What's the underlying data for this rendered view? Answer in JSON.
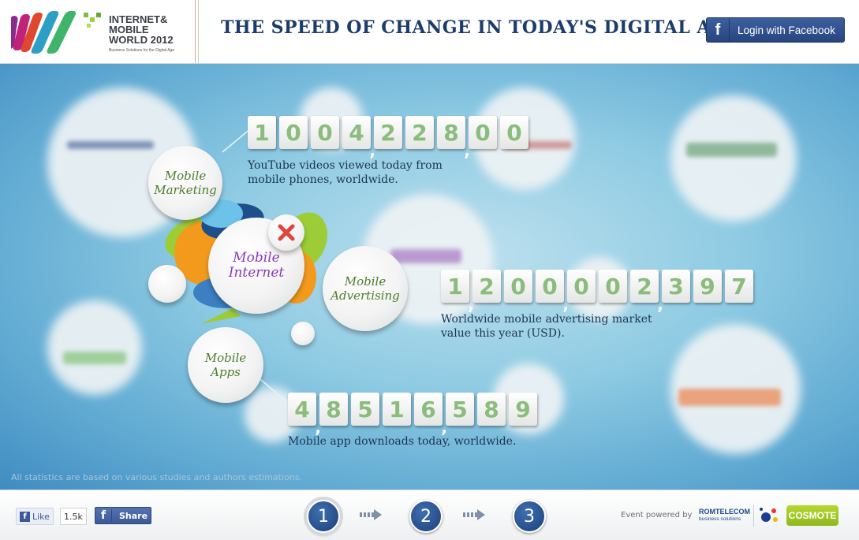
{
  "header": {
    "logo_title": "INTERNET& MOBILE WORLD 2012",
    "logo_subtitle": "Business Solutions for the Digital Age",
    "headline": "THE SPEED OF CHANGE IN TODAY'S DIGITAL AGE",
    "facebook_login_label": "Login with Facebook",
    "facebook_icon_glyph": "f"
  },
  "bubbles": {
    "mobile_internet": [
      "Mobile",
      "Internet"
    ],
    "mobile_marketing": [
      "Mobile",
      "Marketing"
    ],
    "mobile_advertising": [
      "Mobile",
      "Advertising"
    ],
    "mobile_apps": [
      "Mobile",
      "Apps"
    ]
  },
  "counters": [
    {
      "name": "youtube",
      "digits": [
        "1",
        "0",
        "0",
        "4",
        "2",
        "2",
        "8",
        "0",
        "0"
      ],
      "value": "1004228800",
      "caption_line1": "YouTube videos viewed today from",
      "caption_line2": "mobile phones, worldwide."
    },
    {
      "name": "advertising",
      "digits": [
        "1",
        "2",
        "0",
        "0",
        "0",
        "0",
        "2",
        "3",
        "9",
        "7"
      ],
      "value": "1200002397",
      "caption_line1": "Worldwide mobile advertising market",
      "caption_line2": "value this year (USD)."
    },
    {
      "name": "apps",
      "digits": [
        "4",
        "8",
        "5",
        "1",
        "6",
        "5",
        "8",
        "9"
      ],
      "value": "48516589",
      "caption_line1": "Mobile app downloads today, worldwide."
    }
  ],
  "stats_note": "All statistics are based on various studies and authors estimations.",
  "footer": {
    "like_label": "Like",
    "like_count": "1.5k",
    "share_label": "Share",
    "steps": [
      "1",
      "2",
      "3"
    ],
    "active_step": "1",
    "powered_by": "Event powered by",
    "sponsor1_name": "ROMTELECOM",
    "sponsor1_sub": "business solutions",
    "sponsor2_name": "COSMOTE"
  },
  "colors": {
    "headline": "#1c3c6a",
    "facebook_blue": "#3b5998",
    "digit_green": "#8abc7c",
    "bubble_green_text": "#4a7d2a",
    "bubble_purple_text": "#8a3ab9",
    "step_blue": "#1c3f7a"
  },
  "icons": {
    "close_button": "close-icon",
    "step_arrow": "arrow-right-icon"
  }
}
